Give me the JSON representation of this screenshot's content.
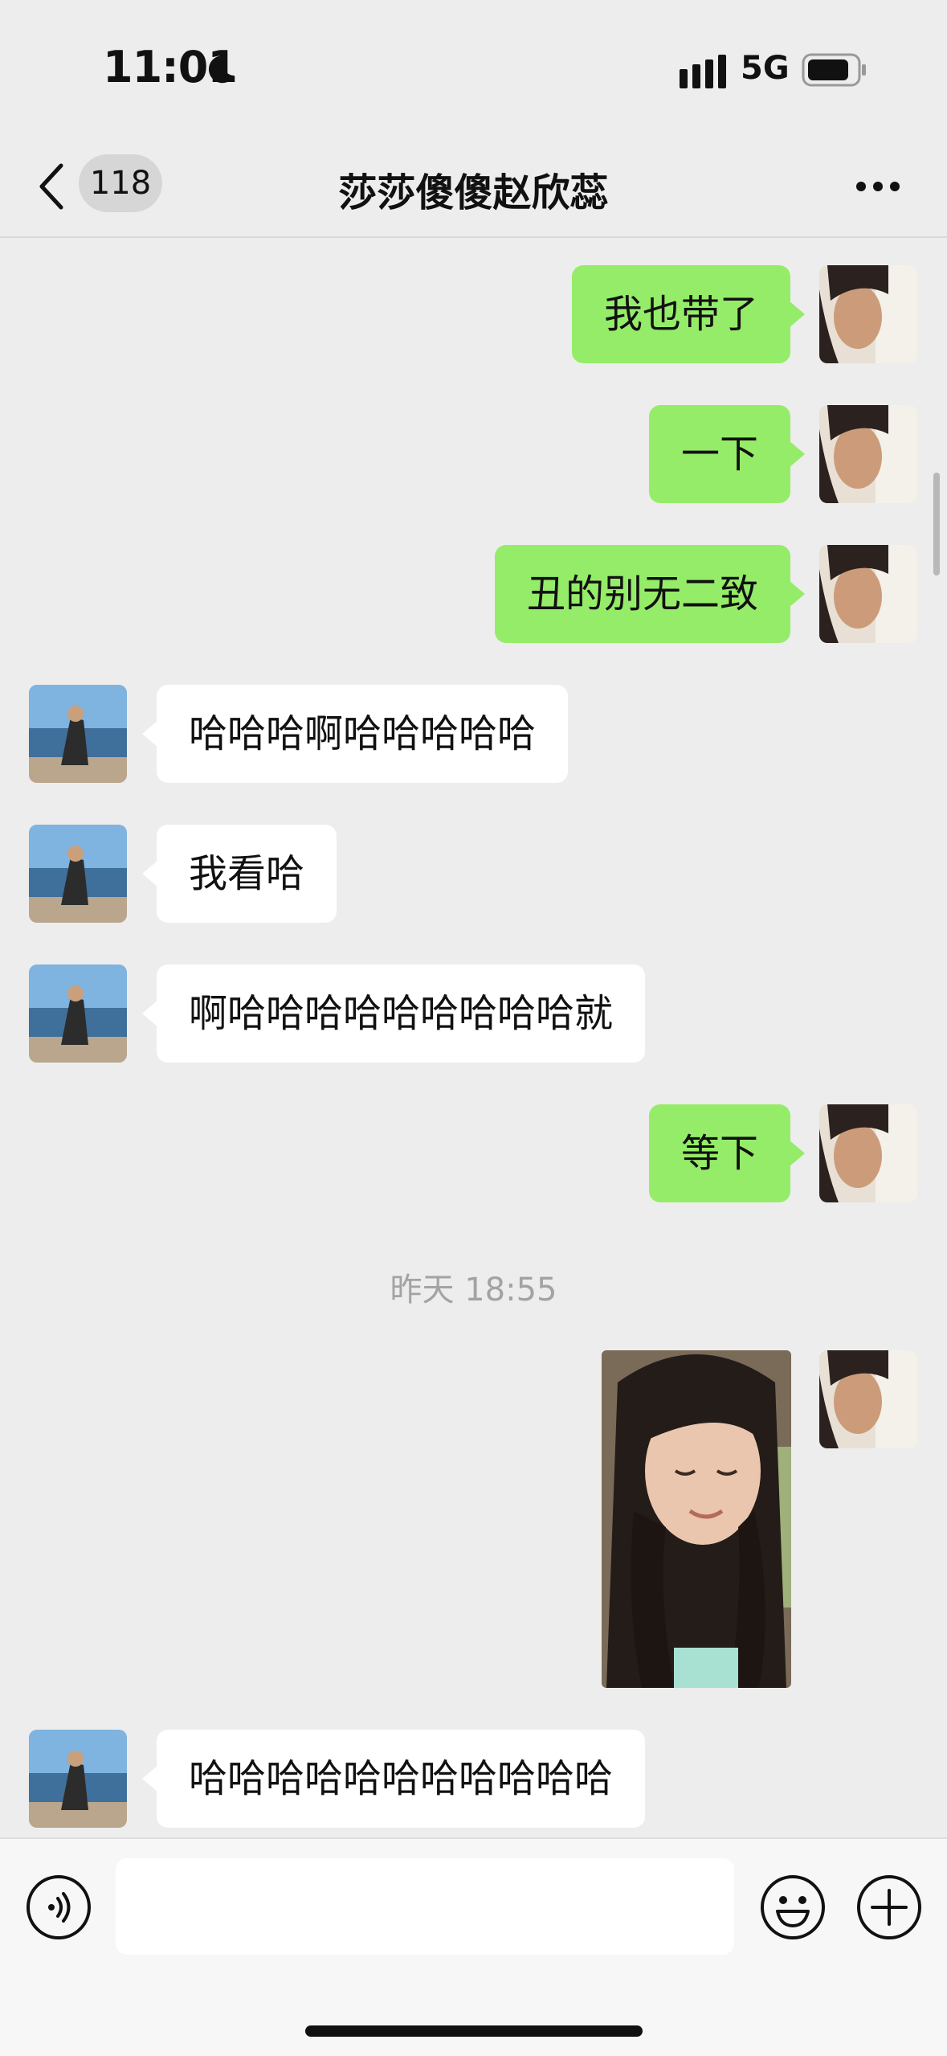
{
  "status_bar": {
    "time": "11:01",
    "network": "5G"
  },
  "nav": {
    "unread_count": "118",
    "title": "莎莎傻傻赵欣蕊"
  },
  "messages": [
    {
      "side": "out",
      "text": "我也带了"
    },
    {
      "side": "out",
      "text": "一下"
    },
    {
      "side": "out",
      "text": "丑的别无二致"
    },
    {
      "side": "in",
      "text": "哈哈哈啊哈哈哈哈哈"
    },
    {
      "side": "in",
      "text": "我看哈"
    },
    {
      "side": "in",
      "text": "啊哈哈哈哈哈哈哈哈哈就"
    },
    {
      "side": "out",
      "text": "等下"
    },
    {
      "timestamp": "昨天 18:55"
    },
    {
      "side": "out",
      "type": "image"
    },
    {
      "side": "in",
      "text": "哈哈哈哈哈哈哈哈哈哈哈"
    }
  ],
  "colors": {
    "outgoing_bubble": "#95ec69",
    "incoming_bubble": "#ffffff",
    "background": "#ededed"
  },
  "icons": [
    "moon-icon",
    "signal-icon",
    "battery-icon",
    "back-chevron-icon",
    "more-icon",
    "voice-icon",
    "emoji-icon",
    "plus-icon"
  ]
}
